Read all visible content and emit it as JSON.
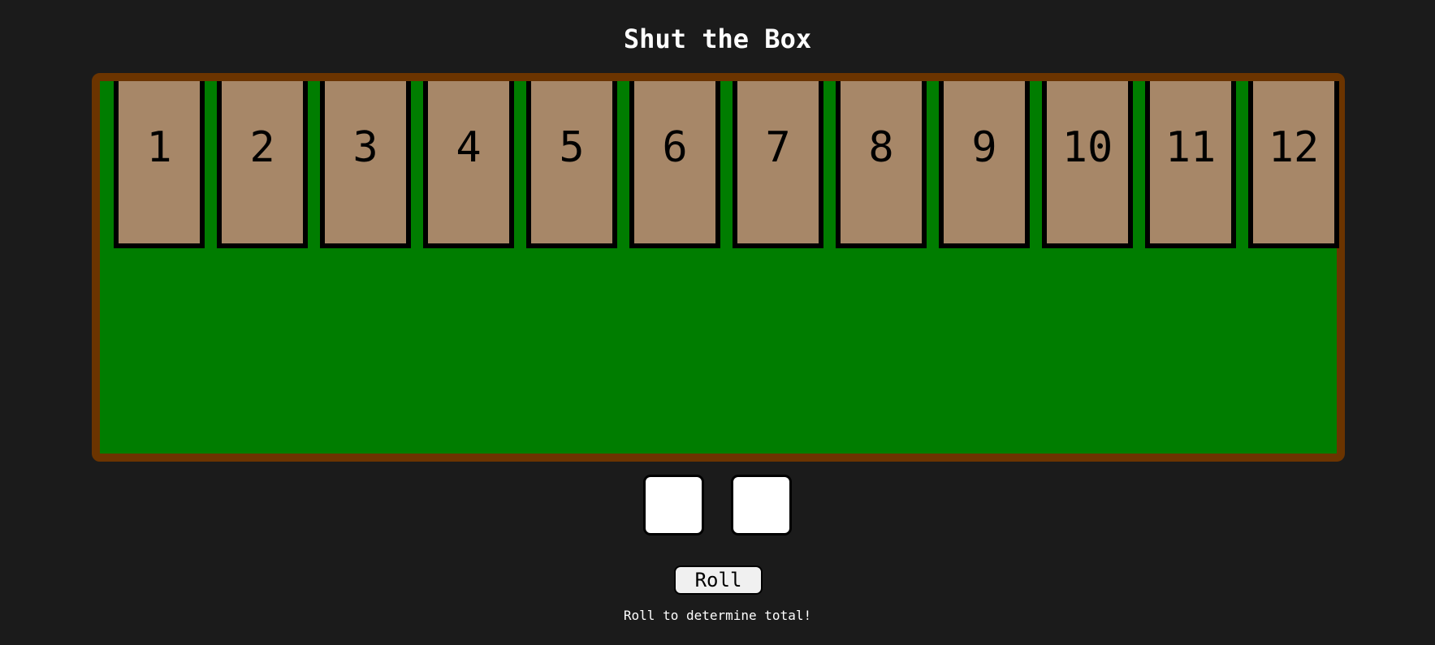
{
  "game": {
    "title": "Shut the Box"
  },
  "board": {
    "tiles": [
      {
        "label": "1"
      },
      {
        "label": "2"
      },
      {
        "label": "3"
      },
      {
        "label": "4"
      },
      {
        "label": "5"
      },
      {
        "label": "6"
      },
      {
        "label": "7"
      },
      {
        "label": "8"
      },
      {
        "label": "9"
      },
      {
        "label": "10"
      },
      {
        "label": "11"
      },
      {
        "label": "12"
      }
    ],
    "felt_color": "#007d00",
    "frame_color": "#6b3400",
    "tile_color": "#a78768"
  },
  "dice": [
    {
      "value": ""
    },
    {
      "value": ""
    }
  ],
  "controls": {
    "roll_label": "Roll"
  },
  "status": {
    "message": "Roll to determine total!"
  }
}
